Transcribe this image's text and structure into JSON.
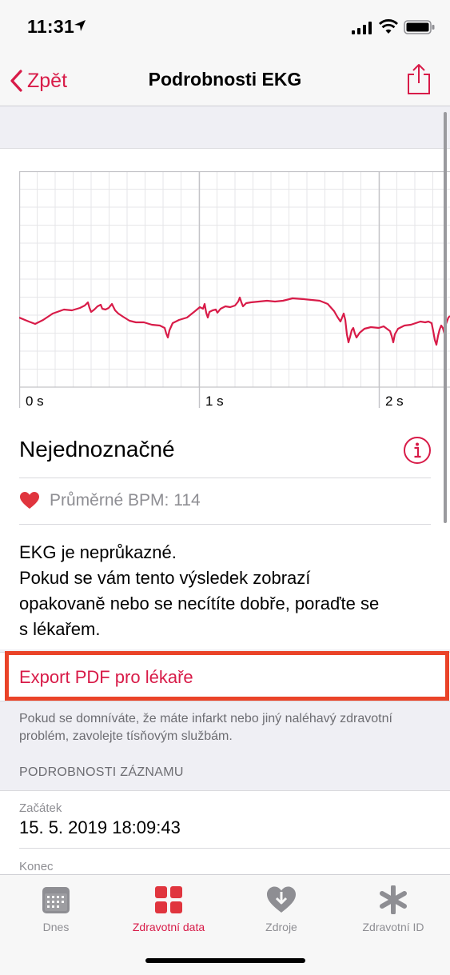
{
  "status": {
    "time": "11:31"
  },
  "nav": {
    "back_label": "Zpět",
    "title": "Podrobnosti EKG",
    "share_icon": "share-icon"
  },
  "colors": {
    "accent": "#d81b48",
    "highlight": "#ea4328",
    "ecg_line": "#d81b48"
  },
  "ecg_chart": {
    "x_ticks": [
      "0 s",
      "1 s",
      "2 s"
    ]
  },
  "result": {
    "title": "Nejednoznačné",
    "bpm_text": "Průměrné BPM: 114",
    "description": [
      "EKG je neprůkazné.",
      "Pokud se vám tento výsledek zobrazí",
      "opakovaně nebo se necítíte dobře, poraďte se",
      "s lékařem."
    ]
  },
  "export": {
    "label": "Export PDF pro lékaře",
    "note": "Pokud se domníváte, že máte infarkt nebo jiný naléhavý zdravotní problém, zavolejte tísňovým službám."
  },
  "record": {
    "section_title": "PODROBNOSTI ZÁZNAMU",
    "start_label": "Začátek",
    "start_value": "15. 5. 2019 18:09:43",
    "end_label": "Konec"
  },
  "tabs": [
    {
      "label": "Dnes",
      "icon": "calendar-icon",
      "active": false
    },
    {
      "label": "Zdravotní data",
      "icon": "health-data-grid-icon",
      "active": true
    },
    {
      "label": "Zdroje",
      "icon": "sources-heart-icon",
      "active": false
    },
    {
      "label": "Zdravotní ID",
      "icon": "medical-id-asterisk-icon",
      "active": false
    }
  ]
}
